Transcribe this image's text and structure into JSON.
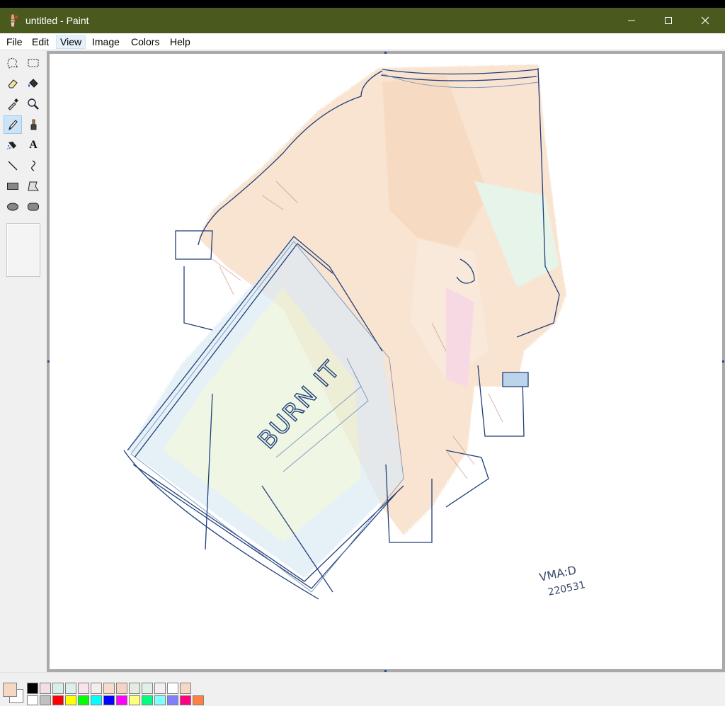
{
  "window": {
    "title": "untitled - Paint",
    "app_icon": "paint-app-icon",
    "buttons": [
      "minimize-icon",
      "maximize-icon",
      "close-icon"
    ],
    "titlebar_color": "#4a5a1f"
  },
  "menubar": {
    "items": [
      {
        "label": "File"
      },
      {
        "label": "Edit"
      },
      {
        "label": "View",
        "highlighted": true
      },
      {
        "label": "Image"
      },
      {
        "label": "Colors"
      },
      {
        "label": "Help"
      }
    ]
  },
  "toolbox": {
    "tools": [
      {
        "name": "free-form-select",
        "icon": "free-select-icon"
      },
      {
        "name": "select",
        "icon": "rect-select-icon"
      },
      {
        "name": "eraser",
        "icon": "eraser-icon"
      },
      {
        "name": "fill-with-color",
        "icon": "fill-bucket-icon"
      },
      {
        "name": "pick-color",
        "icon": "eyedropper-icon"
      },
      {
        "name": "magnifier",
        "icon": "magnifier-icon"
      },
      {
        "name": "pencil",
        "icon": "pencil-icon",
        "selected": true
      },
      {
        "name": "brush",
        "icon": "brush-icon"
      },
      {
        "name": "airbrush",
        "icon": "airbrush-icon"
      },
      {
        "name": "text",
        "icon": "text-icon"
      },
      {
        "name": "line",
        "icon": "line-icon"
      },
      {
        "name": "curve",
        "icon": "curve-icon"
      },
      {
        "name": "rectangle",
        "icon": "rectangle-icon"
      },
      {
        "name": "polygon",
        "icon": "polygon-icon"
      },
      {
        "name": "ellipse",
        "icon": "ellipse-icon"
      },
      {
        "name": "rounded-rectangle",
        "icon": "rounded-rect-icon"
      }
    ],
    "text_glyph": "A"
  },
  "canvas": {
    "drawing_text": "BURN IT",
    "signature_line1": "VMA:D",
    "signature_line2": "220531"
  },
  "palette": {
    "foreground": "#f4d8c4",
    "background": "#ffffff",
    "row1": [
      "#000000",
      "#f3dde6",
      "#d8efe7",
      "#dcefe8",
      "#f7e4ea",
      "#f7ecec",
      "#f8dccb",
      "#f2d4c1",
      "#e6ebdf",
      "#dff1e6",
      "#f4f0f2",
      "#ffffff",
      "#f6d8c4"
    ],
    "row2": [
      "#ffffff",
      "#c0c0c0",
      "#ff0000",
      "#ffff00",
      "#00ff00",
      "#00ffff",
      "#0000ff",
      "#ff00ff",
      "#ffff80",
      "#00ff80",
      "#80ffff",
      "#8080ff",
      "#ff0080",
      "#ff8040"
    ]
  }
}
